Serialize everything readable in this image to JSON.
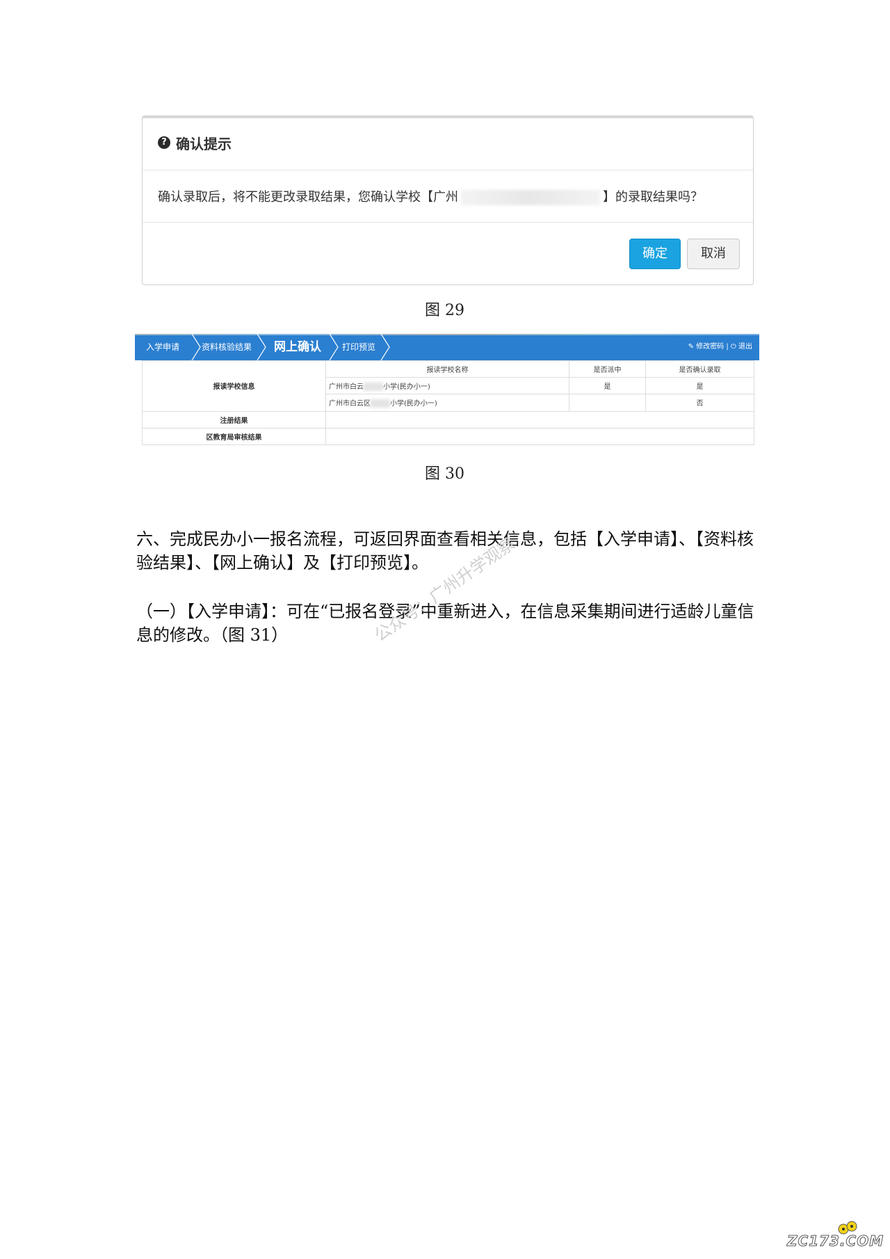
{
  "dialog": {
    "title": "确认提示",
    "message_before": "确认录取后，将不能更改录取结果，您确认学校【广州",
    "message_after": "】的录取结果吗？",
    "ok_label": "确定",
    "cancel_label": "取消",
    "colors": {
      "ok": "#1aa3e0"
    }
  },
  "captions": {
    "fig29": "图 29",
    "fig30": "图 30"
  },
  "nav": {
    "steps": [
      {
        "label": "入学申请"
      },
      {
        "label": "资料核验结果"
      },
      {
        "label": "网上确认"
      },
      {
        "label": "打印预览"
      }
    ],
    "active_step": "网上确认",
    "change_password": "修改密码",
    "separator": "|",
    "logout": "退出",
    "colors": {
      "bar": "#2b7fd0"
    }
  },
  "table": {
    "headers": [
      "报读学校名称",
      "是否派中",
      "是否确认录取"
    ],
    "group_label": "报读学校信息",
    "rows": [
      {
        "school_prefix": "广州市白云",
        "school_suffix": "小学(民办小一)",
        "assigned": "是",
        "confirmed": "是"
      },
      {
        "school_prefix": "广州市白云区",
        "school_suffix": "小学(民办小一)",
        "assigned": "",
        "confirmed": "否"
      }
    ],
    "extra_rows": [
      {
        "label": "注册结果"
      },
      {
        "label": "区教育局审核结果"
      }
    ]
  },
  "paragraphs": {
    "p1": "六、完成民办小一报名流程，可返回界面查看相关信息，包括【入学申请】、【资料核验结果】、【网上确认】及【打印预览】。",
    "p2": "（一）【入学申请】：可在“已报名登录”中重新进入，在信息采集期间进行适龄儿童信息的修改。（图 31）"
  },
  "watermark": "公众号：广州升学观察",
  "site_logo": "ZC173.COM"
}
